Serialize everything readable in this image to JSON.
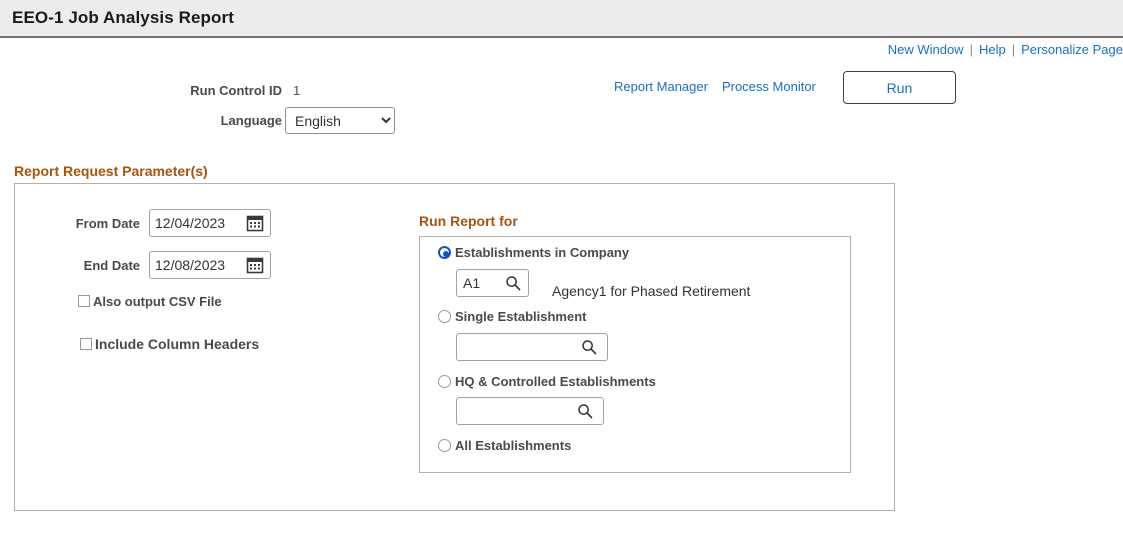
{
  "header": {
    "title": "EEO-1 Job Analysis Report"
  },
  "util_links": {
    "new_window": "New Window",
    "separator": "|",
    "help": "Help",
    "personalize": "Personalize Page"
  },
  "run_control": {
    "id_label": "Run Control ID",
    "id_value": "1",
    "language_label": "Language",
    "language_value": "English",
    "language_options": [
      "English"
    ]
  },
  "process": {
    "report_manager": "Report Manager",
    "process_monitor": "Process Monitor",
    "run_button": "Run"
  },
  "parameters": {
    "heading": "Report Request Parameter(s)",
    "from_date_label": "From Date",
    "from_date_value": "12/04/2023",
    "end_date_label": "End Date",
    "end_date_value": "12/08/2023",
    "csv_checkbox_label": "Also output CSV File",
    "csv_checkbox_checked": false,
    "headers_checkbox_label": "Include Column Headers",
    "headers_checkbox_checked": false
  },
  "run_report_for": {
    "heading": "Run Report for",
    "options": [
      {
        "label": "Establishments in Company",
        "selected": true
      },
      {
        "label": "Single Establishment",
        "selected": false
      },
      {
        "label": "HQ & Controlled Establishments",
        "selected": false
      },
      {
        "label": "All Establishments",
        "selected": false
      }
    ],
    "company_lookup_value": "A1",
    "company_description": "Agency1 for Phased Retirement",
    "single_lookup_value": "",
    "hq_lookup_value": ""
  },
  "icons": {
    "calendar": "calendar-icon",
    "magnifier": "search-icon",
    "dropdown_arrow": "chevron-down-icon"
  },
  "colors": {
    "header_bg": "#eeecea",
    "link_blue": "#1b6ec2",
    "heading_brown": "#a8530e",
    "radio_blue": "#1552c4",
    "panel_border": "#b5b0ab"
  }
}
